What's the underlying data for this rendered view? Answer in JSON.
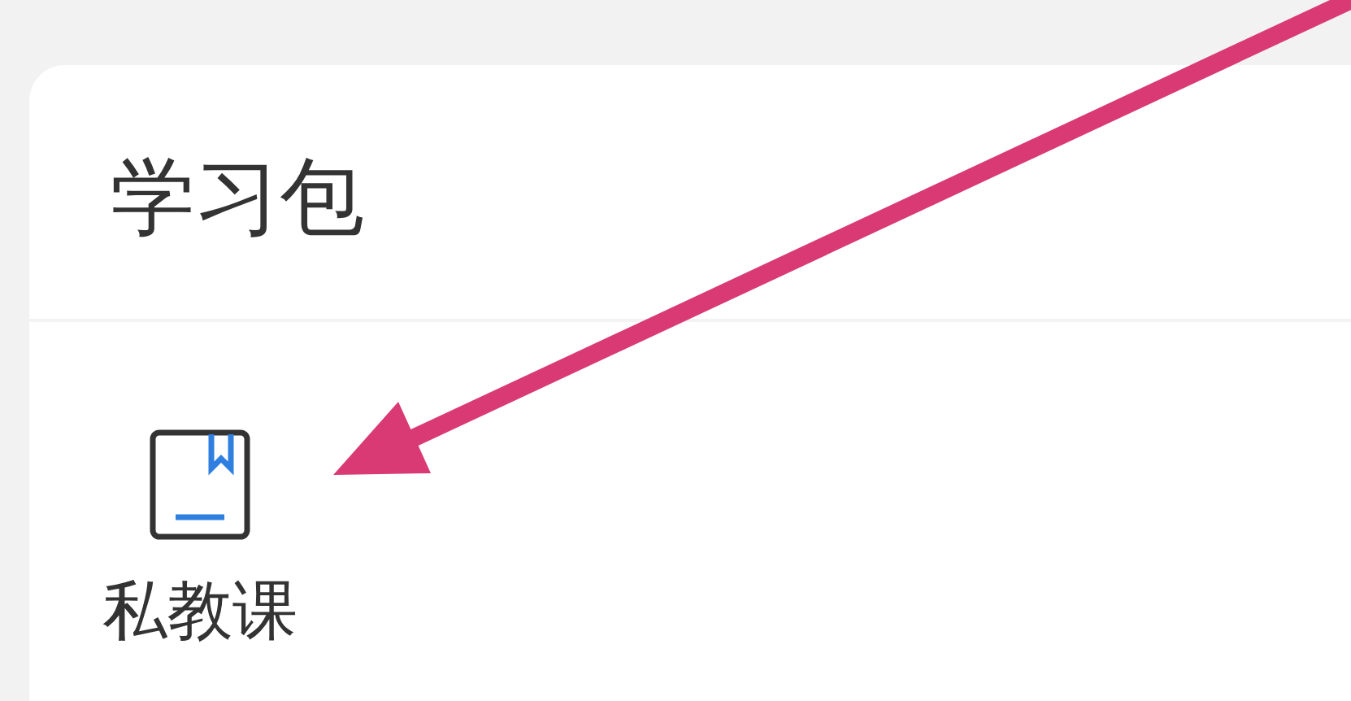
{
  "section": {
    "title": "学习包"
  },
  "items": [
    {
      "label": "私教课"
    }
  ]
}
